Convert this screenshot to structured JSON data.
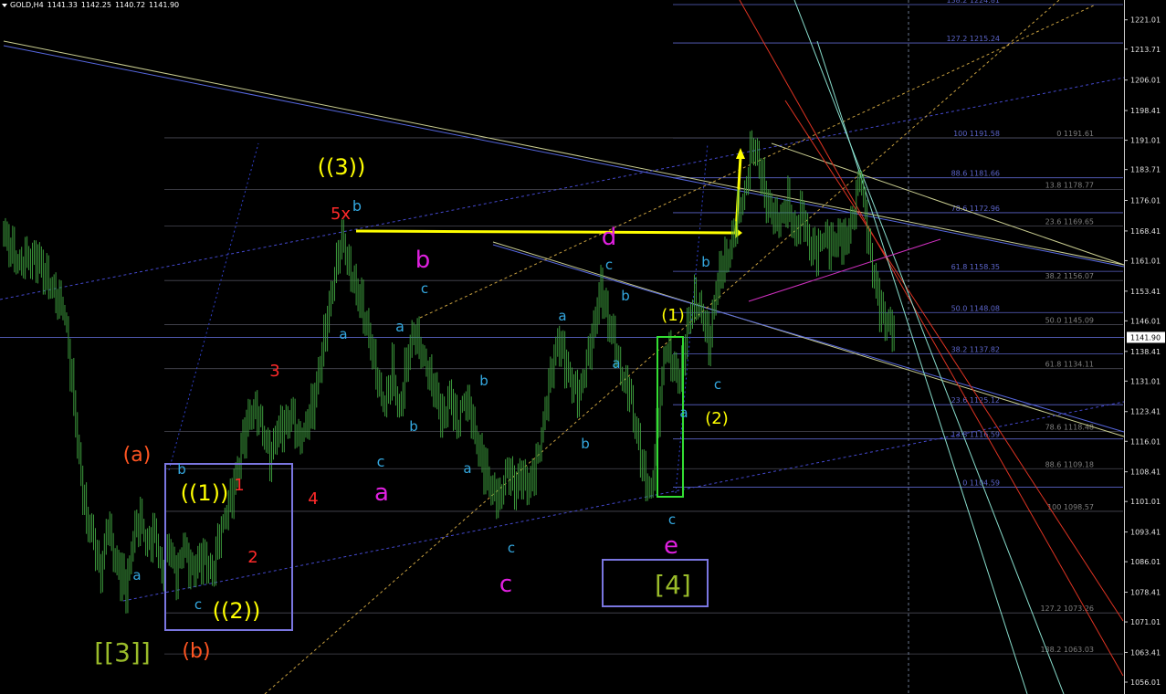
{
  "header": {
    "symbol": "GOLD,H4",
    "open": "1141.33",
    "high": "1142.25",
    "low": "1140.72",
    "close": "1141.90"
  },
  "chart_data": {
    "type": "line",
    "title": "GOLD,H4",
    "price_axis_ticks": [
      "1221.01",
      "1213.71",
      "1206.01",
      "1198.41",
      "1191.01",
      "1183.71",
      "1176.01",
      "1168.41",
      "1161.01",
      "1153.41",
      "1146.01",
      "1138.41",
      "1131.01",
      "1123.41",
      "1116.01",
      "1108.41",
      "1101.01",
      "1093.41",
      "1086.01",
      "1078.41",
      "1071.01",
      "1063.41",
      "1056.01"
    ],
    "ylim": [
      1055,
      1228
    ],
    "current_price": "1141.90",
    "grid": false,
    "colors": {
      "background": "#000000",
      "candles": "#3c9a3c",
      "fib_levels": "#5b64c8",
      "channel_lines": "#c8cc90",
      "wave_blue": "#34a8e0",
      "wave_magenta": "#e020e0",
      "wave_yellow": "#ffff00",
      "wave_red": "#ff2a2a",
      "wave_orange": "#ff5522",
      "wave_olive": "#9abb2a",
      "box_purple": "#7a76e0",
      "box_green": "#33dd33"
    },
    "price_series": [
      {
        "t": 0,
        "p": 1168
      },
      {
        "t": 4,
        "p": 1160
      },
      {
        "t": 9,
        "p": 1162
      },
      {
        "t": 13,
        "p": 1155
      },
      {
        "t": 17,
        "p": 1147
      },
      {
        "t": 19,
        "p": 1130
      },
      {
        "t": 21,
        "p": 1112
      },
      {
        "t": 23,
        "p": 1097
      },
      {
        "t": 25,
        "p": 1092
      },
      {
        "t": 27,
        "p": 1082
      },
      {
        "t": 29,
        "p": 1095
      },
      {
        "t": 31,
        "p": 1086
      },
      {
        "t": 33,
        "p": 1082
      },
      {
        "t": 34,
        "p": 1079
      },
      {
        "t": 36,
        "p": 1092
      },
      {
        "t": 38,
        "p": 1096
      },
      {
        "t": 40,
        "p": 1090
      },
      {
        "t": 42,
        "p": 1094
      },
      {
        "t": 44,
        "p": 1084
      },
      {
        "t": 46,
        "p": 1090
      },
      {
        "t": 48,
        "p": 1082
      },
      {
        "t": 50,
        "p": 1089
      },
      {
        "t": 52,
        "p": 1084
      },
      {
        "t": 54,
        "p": 1086
      },
      {
        "t": 56,
        "p": 1088
      },
      {
        "t": 58,
        "p": 1083
      },
      {
        "t": 60,
        "p": 1092
      },
      {
        "t": 62,
        "p": 1098
      },
      {
        "t": 64,
        "p": 1104
      },
      {
        "t": 66,
        "p": 1115
      },
      {
        "t": 68,
        "p": 1122
      },
      {
        "t": 70,
        "p": 1125
      },
      {
        "t": 72,
        "p": 1118
      },
      {
        "t": 74,
        "p": 1112
      },
      {
        "t": 76,
        "p": 1118
      },
      {
        "t": 78,
        "p": 1120
      },
      {
        "t": 80,
        "p": 1123
      },
      {
        "t": 82,
        "p": 1116
      },
      {
        "t": 84,
        "p": 1120
      },
      {
        "t": 86,
        "p": 1125
      },
      {
        "t": 88,
        "p": 1136
      },
      {
        "t": 90,
        "p": 1146
      },
      {
        "t": 92,
        "p": 1158
      },
      {
        "t": 94,
        "p": 1166
      },
      {
        "t": 96,
        "p": 1160
      },
      {
        "t": 98,
        "p": 1154
      },
      {
        "t": 100,
        "p": 1149
      },
      {
        "t": 102,
        "p": 1140
      },
      {
        "t": 104,
        "p": 1130
      },
      {
        "t": 106,
        "p": 1124
      },
      {
        "t": 108,
        "p": 1134
      },
      {
        "t": 110,
        "p": 1124
      },
      {
        "t": 112,
        "p": 1136
      },
      {
        "t": 114,
        "p": 1144
      },
      {
        "t": 116,
        "p": 1137
      },
      {
        "t": 118,
        "p": 1133
      },
      {
        "t": 120,
        "p": 1128
      },
      {
        "t": 122,
        "p": 1122
      },
      {
        "t": 124,
        "p": 1128
      },
      {
        "t": 126,
        "p": 1120
      },
      {
        "t": 128,
        "p": 1126
      },
      {
        "t": 130,
        "p": 1122
      },
      {
        "t": 132,
        "p": 1114
      },
      {
        "t": 134,
        "p": 1108
      },
      {
        "t": 136,
        "p": 1104
      },
      {
        "t": 138,
        "p": 1101
      },
      {
        "t": 140,
        "p": 1110
      },
      {
        "t": 142,
        "p": 1104
      },
      {
        "t": 144,
        "p": 1108
      },
      {
        "t": 146,
        "p": 1104
      },
      {
        "t": 148,
        "p": 1110
      },
      {
        "t": 150,
        "p": 1120
      },
      {
        "t": 152,
        "p": 1133
      },
      {
        "t": 154,
        "p": 1142
      },
      {
        "t": 156,
        "p": 1136
      },
      {
        "t": 158,
        "p": 1130
      },
      {
        "t": 160,
        "p": 1126
      },
      {
        "t": 162,
        "p": 1136
      },
      {
        "t": 164,
        "p": 1144
      },
      {
        "t": 166,
        "p": 1156
      },
      {
        "t": 168,
        "p": 1146
      },
      {
        "t": 170,
        "p": 1140
      },
      {
        "t": 172,
        "p": 1130
      },
      {
        "t": 174,
        "p": 1128
      },
      {
        "t": 176,
        "p": 1118
      },
      {
        "t": 178,
        "p": 1108
      },
      {
        "t": 180,
        "p": 1104
      },
      {
        "t": 182,
        "p": 1122
      },
      {
        "t": 184,
        "p": 1140
      },
      {
        "t": 186,
        "p": 1134
      },
      {
        "t": 188,
        "p": 1132
      },
      {
        "t": 190,
        "p": 1144
      },
      {
        "t": 192,
        "p": 1152
      },
      {
        "t": 194,
        "p": 1148
      },
      {
        "t": 196,
        "p": 1140
      },
      {
        "t": 198,
        "p": 1154
      },
      {
        "t": 200,
        "p": 1160
      },
      {
        "t": 202,
        "p": 1164
      },
      {
        "t": 204,
        "p": 1172
      },
      {
        "t": 206,
        "p": 1178
      },
      {
        "t": 208,
        "p": 1190
      },
      {
        "t": 210,
        "p": 1186
      },
      {
        "t": 212,
        "p": 1175
      },
      {
        "t": 214,
        "p": 1172
      },
      {
        "t": 216,
        "p": 1170
      },
      {
        "t": 218,
        "p": 1176
      },
      {
        "t": 220,
        "p": 1168
      },
      {
        "t": 222,
        "p": 1174
      },
      {
        "t": 224,
        "p": 1165
      },
      {
        "t": 226,
        "p": 1162
      },
      {
        "t": 228,
        "p": 1167
      },
      {
        "t": 230,
        "p": 1164
      },
      {
        "t": 232,
        "p": 1168
      },
      {
        "t": 234,
        "p": 1166
      },
      {
        "t": 236,
        "p": 1172
      },
      {
        "t": 238,
        "p": 1182
      },
      {
        "t": 240,
        "p": 1168
      },
      {
        "t": 242,
        "p": 1156
      },
      {
        "t": 244,
        "p": 1148
      },
      {
        "t": 246,
        "p": 1146
      },
      {
        "t": 248,
        "p": 1142
      }
    ],
    "fib_levels_upper": [
      {
        "label": "138.2 1224.81",
        "price": 1224.81
      },
      {
        "label": "127.2 1215.24",
        "price": 1215.24
      },
      {
        "label": "100 1191.58",
        "price": 1191.58
      },
      {
        "label": "88.6 1181.66",
        "price": 1181.66
      },
      {
        "label": "78.6 1172.96",
        "price": 1172.96
      },
      {
        "label": "61.8 1158.35",
        "price": 1158.35
      },
      {
        "label": "50.0 1148.08",
        "price": 1148.08
      },
      {
        "label": "38.2 1137.82",
        "price": 1137.82
      },
      {
        "label": "23.6 1125.12",
        "price": 1125.12
      },
      {
        "label": "13.8 1116.59",
        "price": 1116.59
      },
      {
        "label": "0 1104.59",
        "price": 1104.59
      }
    ],
    "fib_levels_lower": [
      {
        "label": "0 1191.61",
        "price": 1191.61
      },
      {
        "label": "13.8 1178.77",
        "price": 1178.77
      },
      {
        "label": "23.6 1169.65",
        "price": 1169.65
      },
      {
        "label": "38.2 1156.07",
        "price": 1156.07
      },
      {
        "label": "50.0 1145.09",
        "price": 1145.09
      },
      {
        "label": "61.8 1134.11",
        "price": 1134.11
      },
      {
        "label": "78.6 1118.48",
        "price": 1118.48
      },
      {
        "label": "88.6 1109.18",
        "price": 1109.18
      },
      {
        "label": "100 1098.57",
        "price": 1098.57
      },
      {
        "label": "127.2 1073.26",
        "price": 1073.26
      },
      {
        "label": "138.2 1063.03",
        "price": 1063.03
      }
    ],
    "wave_labels": [
      {
        "text": "((3))",
        "color": "yellow"
      },
      {
        "text": "5x",
        "color": "red"
      },
      {
        "text": "b",
        "color": "blue"
      },
      {
        "text": "b",
        "color": "magenta"
      },
      {
        "text": "c",
        "color": "blue"
      },
      {
        "text": "a",
        "color": "blue"
      },
      {
        "text": "a",
        "color": "blue"
      },
      {
        "text": "3",
        "color": "red"
      },
      {
        "text": "b",
        "color": "blue"
      },
      {
        "text": "c",
        "color": "blue"
      },
      {
        "text": "a",
        "color": "magenta"
      },
      {
        "text": "4",
        "color": "red"
      },
      {
        "text": "(a)",
        "color": "orange"
      },
      {
        "text": "b",
        "color": "blue"
      },
      {
        "text": "((1))",
        "color": "yellow"
      },
      {
        "text": "1",
        "color": "red"
      },
      {
        "text": "2",
        "color": "red"
      },
      {
        "text": "a",
        "color": "blue"
      },
      {
        "text": "c",
        "color": "blue"
      },
      {
        "text": "((2))",
        "color": "yellow"
      },
      {
        "text": "[[3]]",
        "color": "olive"
      },
      {
        "text": "(b)",
        "color": "orange"
      },
      {
        "text": "b",
        "color": "blue"
      },
      {
        "text": "a",
        "color": "blue"
      },
      {
        "text": "c",
        "color": "blue"
      },
      {
        "text": "c",
        "color": "magenta"
      },
      {
        "text": "a",
        "color": "blue"
      },
      {
        "text": "b",
        "color": "blue"
      },
      {
        "text": "c",
        "color": "blue"
      },
      {
        "text": "d",
        "color": "magenta"
      },
      {
        "text": "b",
        "color": "blue"
      },
      {
        "text": "a",
        "color": "blue"
      },
      {
        "text": "(1)",
        "color": "yellow"
      },
      {
        "text": "b",
        "color": "blue"
      },
      {
        "text": "c",
        "color": "blue"
      },
      {
        "text": "a",
        "color": "blue"
      },
      {
        "text": "(2)",
        "color": "yellow"
      },
      {
        "text": "c",
        "color": "blue"
      },
      {
        "text": "e",
        "color": "magenta"
      },
      {
        "text": "[4]",
        "color": "olive"
      }
    ]
  }
}
